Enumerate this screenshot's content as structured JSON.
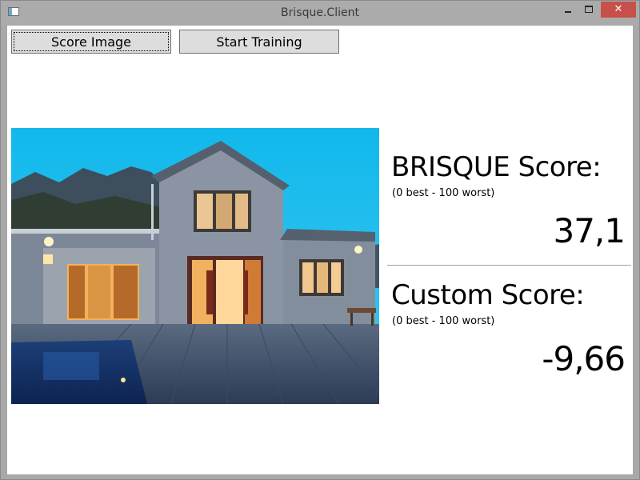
{
  "window": {
    "title": "Brisque.Client",
    "minimize_glyph": "",
    "maximize_glyph": "",
    "close_glyph": "✕"
  },
  "toolbar": {
    "score_image_label": "Score Image",
    "start_training_label": "Start Training"
  },
  "brisque": {
    "label": "BRISQUE Score:",
    "range_hint": "(0 best - 100 worst)",
    "value": "37,1"
  },
  "custom": {
    "label": "Custom Score:",
    "range_hint": "(0 best - 100 worst)",
    "value": "-9,66"
  },
  "icons": {
    "app": "app-window-icon",
    "minimize": "minimize-icon",
    "maximize": "maximize-icon",
    "close": "close-icon"
  },
  "colors": {
    "close_button": "#c7504a",
    "titlebar": "#ababab",
    "button_face": "#dddddd",
    "sky": "#16b6e8"
  }
}
